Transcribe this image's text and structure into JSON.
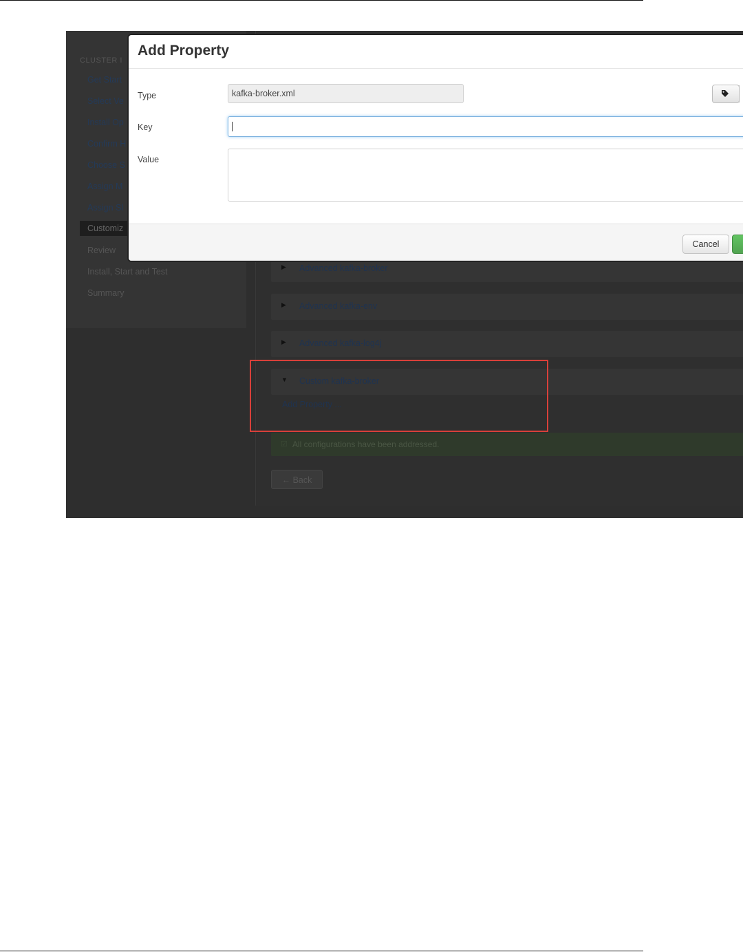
{
  "wizard": {
    "heading": "CLUSTER I",
    "steps": [
      {
        "label": "Get Start"
      },
      {
        "label": "Select Ve"
      },
      {
        "label": "Install Op"
      },
      {
        "label": "Confirm H"
      },
      {
        "label": "Choose S"
      },
      {
        "label": "Assign M"
      },
      {
        "label": "Assign Sl"
      },
      {
        "label": "Customiz"
      },
      {
        "label": "Review"
      },
      {
        "label": "Install, Start and Test"
      },
      {
        "label": "Summary"
      }
    ]
  },
  "config": {
    "sections": [
      {
        "title": "Advanced kafka-broker",
        "expanded": false
      },
      {
        "title": "Advanced kafka-env",
        "expanded": false
      },
      {
        "title": "Advanced kafka-log4j",
        "expanded": false
      },
      {
        "title": "Custom kafka-broker",
        "expanded": true
      }
    ],
    "add_property_link": "Add Property ...",
    "alert_message": "All configurations have been addressed.",
    "back_button": "← Back"
  },
  "modal": {
    "title": "Add Property",
    "type_label": "Type",
    "type_value": "kafka-broker.xml",
    "key_label": "Key",
    "key_value": "",
    "value_label": "Value",
    "value_value": "",
    "cancel_button": "Cancel"
  },
  "colors": {
    "highlight_border": "#d9403a",
    "primary_button": "#51a351",
    "focus_ring": "#52a8ec"
  }
}
